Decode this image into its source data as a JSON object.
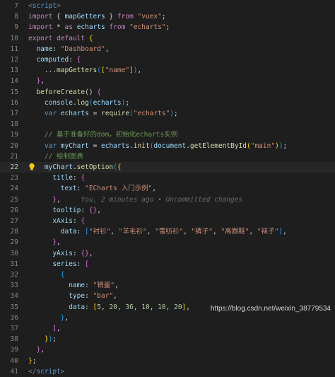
{
  "editor": {
    "colors": {
      "background": "#1e1e1e",
      "keyword_blue": "#569cd6",
      "keyword_pink": "#c586c0",
      "string": "#ce9178",
      "identifier": "#9cdcfe",
      "function": "#dcdcaa",
      "number": "#b5cea8",
      "comment": "#6a9955",
      "punct": "#d4d4d4",
      "bracket_gold": "#ffd700",
      "bracket_pink": "#da70d6",
      "bracket_blue": "#179fff"
    },
    "current_line": 22,
    "blame_text": "You, 2 minutes ago • Uncommitted changes",
    "lines": [
      {
        "n": "7",
        "tokens": [
          {
            "t": "<",
            "c": "#808080"
          },
          {
            "t": "script",
            "c": "#569cd6"
          },
          {
            "t": ">",
            "c": "#808080"
          }
        ]
      },
      {
        "n": "8",
        "tokens": [
          {
            "t": "import",
            "c": "#c586c0"
          },
          {
            "t": " { ",
            "c": "#d4d4d4"
          },
          {
            "t": "mapGetters",
            "c": "#9cdcfe"
          },
          {
            "t": " } ",
            "c": "#d4d4d4"
          },
          {
            "t": "from",
            "c": "#c586c0"
          },
          {
            "t": " ",
            "c": "#d4d4d4"
          },
          {
            "t": "\"vuex\"",
            "c": "#ce9178"
          },
          {
            "t": ";",
            "c": "#d4d4d4"
          }
        ]
      },
      {
        "n": "9",
        "tokens": [
          {
            "t": "import",
            "c": "#c586c0"
          },
          {
            "t": " * ",
            "c": "#d4d4d4"
          },
          {
            "t": "as",
            "c": "#c586c0"
          },
          {
            "t": " ",
            "c": "#d4d4d4"
          },
          {
            "t": "echarts",
            "c": "#9cdcfe"
          },
          {
            "t": " ",
            "c": "#d4d4d4"
          },
          {
            "t": "from",
            "c": "#c586c0"
          },
          {
            "t": " ",
            "c": "#d4d4d4"
          },
          {
            "t": "\"echarts\"",
            "c": "#ce9178"
          },
          {
            "t": ";",
            "c": "#d4d4d4"
          }
        ]
      },
      {
        "n": "10",
        "tokens": [
          {
            "t": "export",
            "c": "#c586c0"
          },
          {
            "t": " ",
            "c": "#d4d4d4"
          },
          {
            "t": "default",
            "c": "#c586c0"
          },
          {
            "t": " ",
            "c": "#d4d4d4"
          },
          {
            "t": "{",
            "c": "#ffd700"
          }
        ]
      },
      {
        "n": "11",
        "tokens": [
          {
            "t": "  name",
            "c": "#9cdcfe"
          },
          {
            "t": ": ",
            "c": "#d4d4d4"
          },
          {
            "t": "\"Dashboard\"",
            "c": "#ce9178"
          },
          {
            "t": ",",
            "c": "#d4d4d4"
          }
        ]
      },
      {
        "n": "12",
        "tokens": [
          {
            "t": "  computed",
            "c": "#9cdcfe"
          },
          {
            "t": ": ",
            "c": "#d4d4d4"
          },
          {
            "t": "{",
            "c": "#da70d6"
          }
        ]
      },
      {
        "n": "13",
        "tokens": [
          {
            "t": "    ...",
            "c": "#d4d4d4"
          },
          {
            "t": "mapGetters",
            "c": "#dcdcaa"
          },
          {
            "t": "(",
            "c": "#179fff"
          },
          {
            "t": "[",
            "c": "#ffd700"
          },
          {
            "t": "\"name\"",
            "c": "#ce9178"
          },
          {
            "t": "]",
            "c": "#ffd700"
          },
          {
            "t": ")",
            "c": "#179fff"
          },
          {
            "t": ",",
            "c": "#d4d4d4"
          }
        ]
      },
      {
        "n": "14",
        "tokens": [
          {
            "t": "  ",
            "c": "#d4d4d4"
          },
          {
            "t": "}",
            "c": "#da70d6"
          },
          {
            "t": ",",
            "c": "#d4d4d4"
          }
        ]
      },
      {
        "n": "15",
        "tokens": [
          {
            "t": "  ",
            "c": "#d4d4d4"
          },
          {
            "t": "beforeCreate",
            "c": "#dcdcaa"
          },
          {
            "t": "() ",
            "c": "#d4d4d4"
          },
          {
            "t": "{",
            "c": "#da70d6"
          }
        ]
      },
      {
        "n": "16",
        "tokens": [
          {
            "t": "    ",
            "c": "#d4d4d4"
          },
          {
            "t": "console",
            "c": "#9cdcfe"
          },
          {
            "t": ".",
            "c": "#d4d4d4"
          },
          {
            "t": "log",
            "c": "#dcdcaa"
          },
          {
            "t": "(",
            "c": "#179fff"
          },
          {
            "t": "echarts",
            "c": "#9cdcfe"
          },
          {
            "t": ")",
            "c": "#179fff"
          },
          {
            "t": ";",
            "c": "#d4d4d4"
          }
        ]
      },
      {
        "n": "17",
        "tokens": [
          {
            "t": "    ",
            "c": "#d4d4d4"
          },
          {
            "t": "var",
            "c": "#569cd6"
          },
          {
            "t": " ",
            "c": "#d4d4d4"
          },
          {
            "t": "echarts",
            "c": "#9cdcfe"
          },
          {
            "t": " = ",
            "c": "#d4d4d4"
          },
          {
            "t": "require",
            "c": "#dcdcaa"
          },
          {
            "t": "(",
            "c": "#179fff"
          },
          {
            "t": "\"echarts\"",
            "c": "#ce9178"
          },
          {
            "t": ")",
            "c": "#179fff"
          },
          {
            "t": ";",
            "c": "#d4d4d4"
          }
        ]
      },
      {
        "n": "18",
        "tokens": []
      },
      {
        "n": "19",
        "tokens": [
          {
            "t": "    // 基于准备好的dom，初始化echarts实例",
            "c": "#6a9955"
          }
        ]
      },
      {
        "n": "20",
        "tokens": [
          {
            "t": "    ",
            "c": "#d4d4d4"
          },
          {
            "t": "var",
            "c": "#569cd6"
          },
          {
            "t": " ",
            "c": "#d4d4d4"
          },
          {
            "t": "myChart",
            "c": "#9cdcfe"
          },
          {
            "t": " = ",
            "c": "#d4d4d4"
          },
          {
            "t": "echarts",
            "c": "#9cdcfe"
          },
          {
            "t": ".",
            "c": "#d4d4d4"
          },
          {
            "t": "init",
            "c": "#dcdcaa"
          },
          {
            "t": "(",
            "c": "#179fff"
          },
          {
            "t": "document",
            "c": "#9cdcfe"
          },
          {
            "t": ".",
            "c": "#d4d4d4"
          },
          {
            "t": "getElementById",
            "c": "#dcdcaa"
          },
          {
            "t": "(",
            "c": "#ffd700"
          },
          {
            "t": "\"main\"",
            "c": "#ce9178"
          },
          {
            "t": ")",
            "c": "#ffd700"
          },
          {
            "t": ")",
            "c": "#179fff"
          },
          {
            "t": ";",
            "c": "#d4d4d4"
          }
        ]
      },
      {
        "n": "21",
        "tokens": [
          {
            "t": "    // 绘制图表",
            "c": "#6a9955"
          }
        ]
      },
      {
        "n": "22",
        "tokens": [
          {
            "t": "    ",
            "c": "#d4d4d4"
          },
          {
            "t": "myChart",
            "c": "#9cdcfe"
          },
          {
            "t": ".",
            "c": "#d4d4d4"
          },
          {
            "t": "setOption",
            "c": "#dcdcaa"
          },
          {
            "t": "(",
            "c": "#179fff"
          },
          {
            "t": "{",
            "c": "#ffd700"
          }
        ]
      },
      {
        "n": "23",
        "tokens": [
          {
            "t": "      ",
            "c": "#d4d4d4"
          },
          {
            "t": "title",
            "c": "#9cdcfe"
          },
          {
            "t": ": ",
            "c": "#d4d4d4"
          },
          {
            "t": "{",
            "c": "#da70d6"
          }
        ]
      },
      {
        "n": "24",
        "tokens": [
          {
            "t": "        ",
            "c": "#d4d4d4"
          },
          {
            "t": "text",
            "c": "#9cdcfe"
          },
          {
            "t": ": ",
            "c": "#d4d4d4"
          },
          {
            "t": "\"ECharts 入门示例\"",
            "c": "#ce9178"
          },
          {
            "t": ",",
            "c": "#d4d4d4"
          }
        ]
      },
      {
        "n": "25",
        "blame": true,
        "tokens": [
          {
            "t": "      ",
            "c": "#d4d4d4"
          },
          {
            "t": "}",
            "c": "#da70d6"
          },
          {
            "t": ",",
            "c": "#d4d4d4"
          }
        ]
      },
      {
        "n": "26",
        "tokens": [
          {
            "t": "      ",
            "c": "#d4d4d4"
          },
          {
            "t": "tooltip",
            "c": "#9cdcfe"
          },
          {
            "t": ": ",
            "c": "#d4d4d4"
          },
          {
            "t": "{}",
            "c": "#da70d6"
          },
          {
            "t": ",",
            "c": "#d4d4d4"
          }
        ]
      },
      {
        "n": "27",
        "tokens": [
          {
            "t": "      ",
            "c": "#d4d4d4"
          },
          {
            "t": "xAxis",
            "c": "#9cdcfe"
          },
          {
            "t": ": ",
            "c": "#d4d4d4"
          },
          {
            "t": "{",
            "c": "#da70d6"
          }
        ]
      },
      {
        "n": "28",
        "tokens": [
          {
            "t": "        ",
            "c": "#d4d4d4"
          },
          {
            "t": "data",
            "c": "#9cdcfe"
          },
          {
            "t": ": ",
            "c": "#d4d4d4"
          },
          {
            "t": "[",
            "c": "#179fff"
          },
          {
            "t": "\"衬衫\"",
            "c": "#ce9178"
          },
          {
            "t": ", ",
            "c": "#d4d4d4"
          },
          {
            "t": "\"羊毛衫\"",
            "c": "#ce9178"
          },
          {
            "t": ", ",
            "c": "#d4d4d4"
          },
          {
            "t": "\"雪纺衫\"",
            "c": "#ce9178"
          },
          {
            "t": ", ",
            "c": "#d4d4d4"
          },
          {
            "t": "\"裤子\"",
            "c": "#ce9178"
          },
          {
            "t": ", ",
            "c": "#d4d4d4"
          },
          {
            "t": "\"高跟鞋\"",
            "c": "#ce9178"
          },
          {
            "t": ", ",
            "c": "#d4d4d4"
          },
          {
            "t": "\"袜子\"",
            "c": "#ce9178"
          },
          {
            "t": "]",
            "c": "#179fff"
          },
          {
            "t": ",",
            "c": "#d4d4d4"
          }
        ]
      },
      {
        "n": "29",
        "tokens": [
          {
            "t": "      ",
            "c": "#d4d4d4"
          },
          {
            "t": "}",
            "c": "#da70d6"
          },
          {
            "t": ",",
            "c": "#d4d4d4"
          }
        ]
      },
      {
        "n": "30",
        "tokens": [
          {
            "t": "      ",
            "c": "#d4d4d4"
          },
          {
            "t": "yAxis",
            "c": "#9cdcfe"
          },
          {
            "t": ": ",
            "c": "#d4d4d4"
          },
          {
            "t": "{}",
            "c": "#da70d6"
          },
          {
            "t": ",",
            "c": "#d4d4d4"
          }
        ]
      },
      {
        "n": "31",
        "tokens": [
          {
            "t": "      ",
            "c": "#d4d4d4"
          },
          {
            "t": "series",
            "c": "#9cdcfe"
          },
          {
            "t": ": ",
            "c": "#d4d4d4"
          },
          {
            "t": "[",
            "c": "#da70d6"
          }
        ]
      },
      {
        "n": "32",
        "tokens": [
          {
            "t": "        ",
            "c": "#d4d4d4"
          },
          {
            "t": "{",
            "c": "#179fff"
          }
        ]
      },
      {
        "n": "33",
        "tokens": [
          {
            "t": "          ",
            "c": "#d4d4d4"
          },
          {
            "t": "name",
            "c": "#9cdcfe"
          },
          {
            "t": ": ",
            "c": "#d4d4d4"
          },
          {
            "t": "\"销量\"",
            "c": "#ce9178"
          },
          {
            "t": ",",
            "c": "#d4d4d4"
          }
        ]
      },
      {
        "n": "34",
        "tokens": [
          {
            "t": "          ",
            "c": "#d4d4d4"
          },
          {
            "t": "type",
            "c": "#9cdcfe"
          },
          {
            "t": ": ",
            "c": "#d4d4d4"
          },
          {
            "t": "\"bar\"",
            "c": "#ce9178"
          },
          {
            "t": ",",
            "c": "#d4d4d4"
          }
        ]
      },
      {
        "n": "35",
        "tokens": [
          {
            "t": "          ",
            "c": "#d4d4d4"
          },
          {
            "t": "data",
            "c": "#9cdcfe"
          },
          {
            "t": ": ",
            "c": "#d4d4d4"
          },
          {
            "t": "[",
            "c": "#ffd700"
          },
          {
            "t": "5",
            "c": "#b5cea8"
          },
          {
            "t": ", ",
            "c": "#d4d4d4"
          },
          {
            "t": "20",
            "c": "#b5cea8"
          },
          {
            "t": ", ",
            "c": "#d4d4d4"
          },
          {
            "t": "36",
            "c": "#b5cea8"
          },
          {
            "t": ", ",
            "c": "#d4d4d4"
          },
          {
            "t": "10",
            "c": "#b5cea8"
          },
          {
            "t": ", ",
            "c": "#d4d4d4"
          },
          {
            "t": "10",
            "c": "#b5cea8"
          },
          {
            "t": ", ",
            "c": "#d4d4d4"
          },
          {
            "t": "20",
            "c": "#b5cea8"
          },
          {
            "t": "]",
            "c": "#ffd700"
          },
          {
            "t": ",",
            "c": "#d4d4d4"
          }
        ]
      },
      {
        "n": "36",
        "tokens": [
          {
            "t": "        ",
            "c": "#d4d4d4"
          },
          {
            "t": "}",
            "c": "#179fff"
          },
          {
            "t": ",",
            "c": "#d4d4d4"
          }
        ]
      },
      {
        "n": "37",
        "tokens": [
          {
            "t": "      ",
            "c": "#d4d4d4"
          },
          {
            "t": "]",
            "c": "#da70d6"
          },
          {
            "t": ",",
            "c": "#d4d4d4"
          }
        ]
      },
      {
        "n": "38",
        "tokens": [
          {
            "t": "    ",
            "c": "#d4d4d4"
          },
          {
            "t": "}",
            "c": "#ffd700"
          },
          {
            "t": ")",
            "c": "#179fff"
          },
          {
            "t": ";",
            "c": "#d4d4d4"
          }
        ]
      },
      {
        "n": "39",
        "tokens": [
          {
            "t": "  ",
            "c": "#d4d4d4"
          },
          {
            "t": "}",
            "c": "#da70d6"
          },
          {
            "t": ",",
            "c": "#d4d4d4"
          }
        ]
      },
      {
        "n": "40",
        "tokens": [
          {
            "t": "}",
            "c": "#ffd700"
          },
          {
            "t": ";",
            "c": "#d4d4d4"
          }
        ]
      },
      {
        "n": "41",
        "tokens": [
          {
            "t": "</",
            "c": "#808080"
          },
          {
            "t": "script",
            "c": "#569cd6"
          },
          {
            "t": ">",
            "c": "#808080"
          }
        ]
      }
    ]
  },
  "watermark": "https://blog.csdn.net/weixin_38779534"
}
